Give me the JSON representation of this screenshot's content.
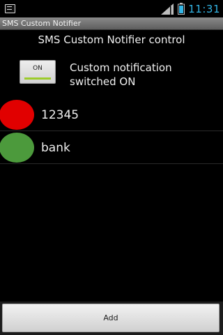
{
  "status_bar": {
    "time": "11:31",
    "icons": [
      "notification-icon",
      "signal-icon",
      "battery-icon"
    ],
    "time_color": "#33b5e5"
  },
  "app_title": "SMS Custom Notifier",
  "heading": "SMS Custom Notifier control",
  "toggle": {
    "label": "ON",
    "state": true,
    "indicator_color": "#9ccc2a",
    "description_line1": "Custom notification",
    "description_line2": "switched ON"
  },
  "contacts": [
    {
      "name": "12345",
      "color": "#e10000"
    },
    {
      "name": "bank",
      "color": "#4c9a3c"
    }
  ],
  "add_button_label": "Add"
}
